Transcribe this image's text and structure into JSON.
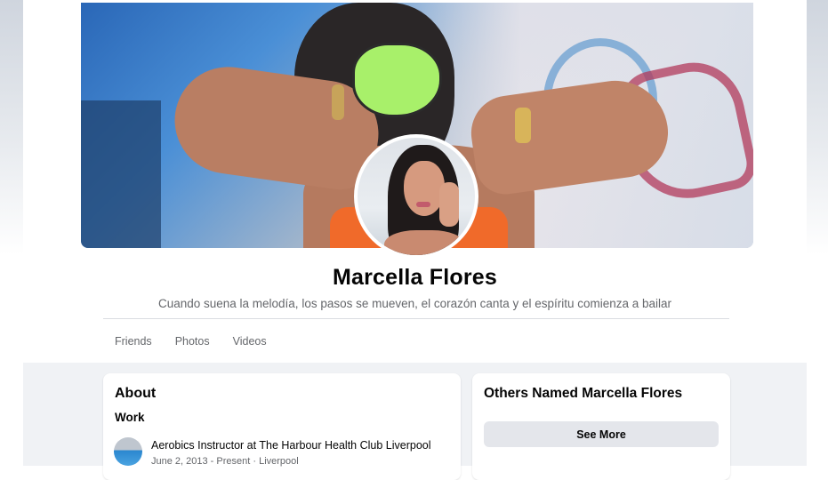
{
  "profile": {
    "name": "Marcella Flores",
    "bio": "Cuando suena la melodía, los pasos se mueven, el corazón canta y el espíritu comienza a bailar"
  },
  "tabs": [
    {
      "label": "Friends"
    },
    {
      "label": "Photos"
    },
    {
      "label": "Videos"
    }
  ],
  "about": {
    "title": "About",
    "section": "Work",
    "work_title": "Aerobics Instructor at The Harbour Health Club Liverpool",
    "work_meta": "June 2, 2013 - Present · Liverpool"
  },
  "others": {
    "title": "Others Named Marcella Flores",
    "see_more_label": "See More"
  },
  "colors": {
    "page_bg": "#f0f2f5",
    "secondary_text": "#65676b",
    "button_bg": "#e4e6eb"
  }
}
